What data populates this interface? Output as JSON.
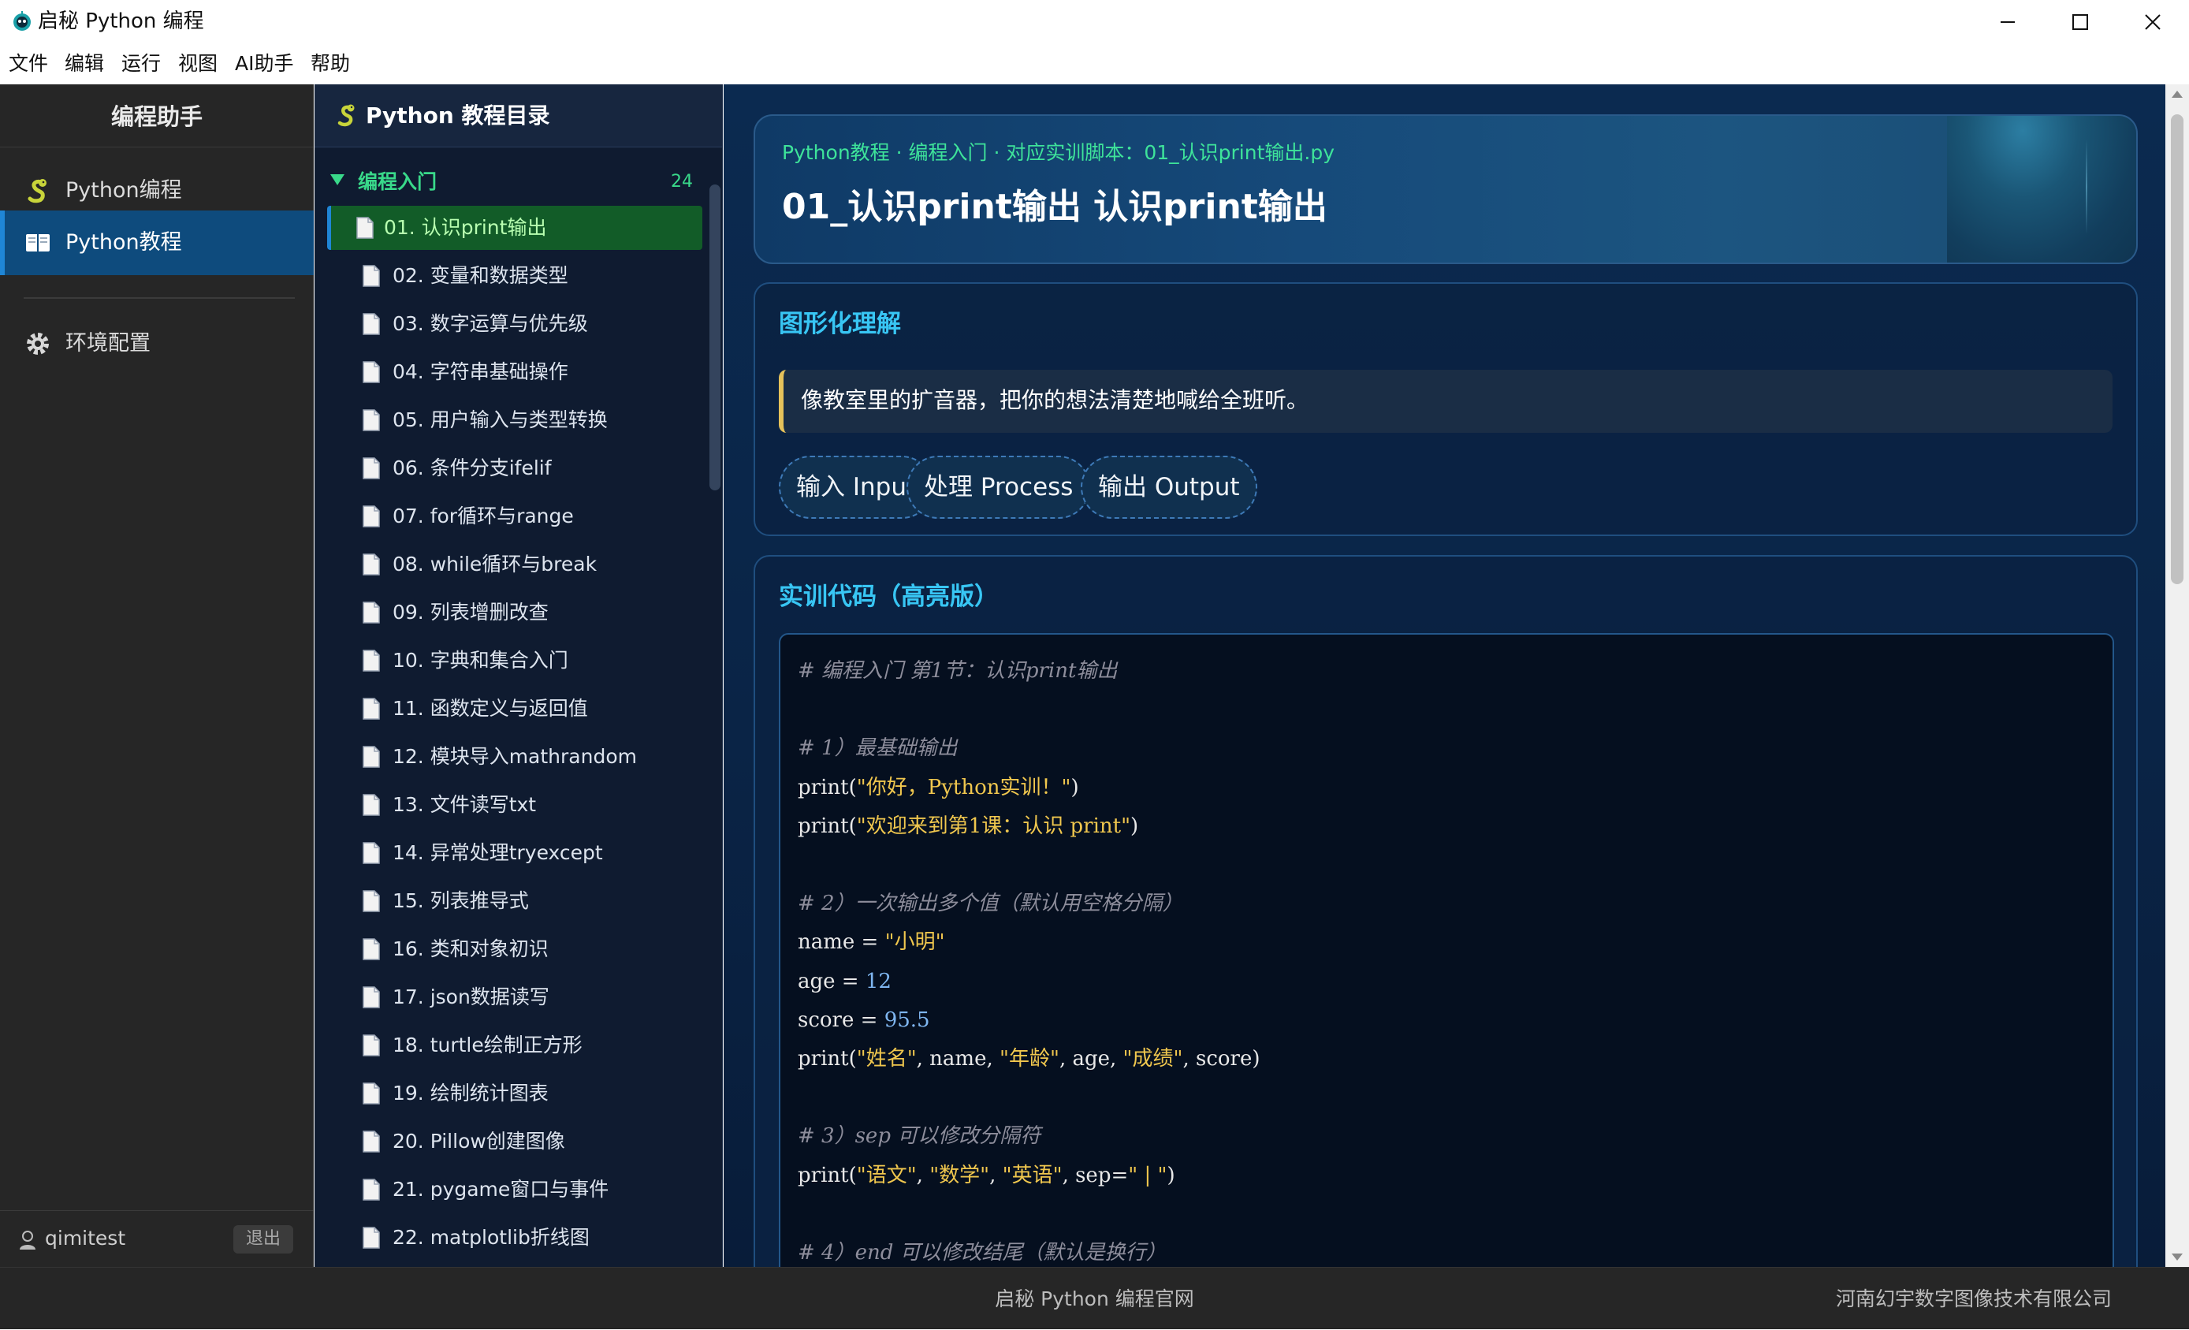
{
  "window": {
    "title": "启秘 Python 编程",
    "icon": "robot-app-icon",
    "controls": [
      "minimize-icon",
      "maximize-icon",
      "close-icon"
    ]
  },
  "menubar": {
    "items": [
      "文件",
      "编辑",
      "运行",
      "视图",
      "AI助手",
      "帮助"
    ]
  },
  "nav": {
    "title": "编程助手",
    "items": [
      {
        "label": "Python编程",
        "icon": "python-snake-icon",
        "active": false
      },
      {
        "label": "Python教程",
        "icon": "book-icon",
        "active": true
      },
      {
        "label": "环境配置",
        "icon": "gear-icon",
        "active": false
      }
    ],
    "user": {
      "name": "qimitest",
      "icon": "user-icon",
      "logout_label": "退出"
    }
  },
  "toc": {
    "title": "Python 教程目录",
    "title_icon": "python-snake-icon",
    "group": {
      "label": "编程入门",
      "count": "24",
      "expanded": true
    },
    "items": [
      "01. 认识print输出",
      "02. 变量和数据类型",
      "03. 数字运算与优先级",
      "04. 字符串基础操作",
      "05. 用户输入与类型转换",
      "06. 条件分支ifelif",
      "07. for循环与range",
      "08. while循环与break",
      "09. 列表增删改查",
      "10. 字典和集合入门",
      "11. 函数定义与返回值",
      "12. 模块导入mathrandom",
      "13. 文件读写txt",
      "14. 异常处理tryexcept",
      "15. 列表推导式",
      "16. 类和对象初识",
      "17. json数据读写",
      "18. turtle绘制正方形",
      "19. 绘制统计图表",
      "20. Pillow创建图像",
      "21. pygame窗口与事件",
      "22. matplotlib折线图"
    ],
    "active_index": 0
  },
  "hero": {
    "breadcrumb": "Python教程 · 编程入门 · 对应实训脚本：01_认识print输出.py",
    "title": "01_认识print输出 认识print输出"
  },
  "concept": {
    "title": "图形化理解",
    "quote": "像教室里的扩音器，把你的想法清楚地喊给全班听。",
    "pills": [
      "输入 Input",
      "处理 Process",
      "输出 Output"
    ]
  },
  "code": {
    "title": "实训代码（高亮版）",
    "lines": [
      [
        {
          "t": "# 编程入门 第1节：认识print输出",
          "k": "c"
        }
      ],
      [],
      [
        {
          "t": "# 1）最基础输出",
          "k": "c"
        }
      ],
      [
        {
          "t": "print(",
          "k": "o"
        },
        {
          "t": "\"你好，Python实训！\"",
          "k": "s"
        },
        {
          "t": ")",
          "k": "o"
        }
      ],
      [
        {
          "t": "print(",
          "k": "o"
        },
        {
          "t": "\"欢迎来到第1课：认识 print\"",
          "k": "s"
        },
        {
          "t": ")",
          "k": "o"
        }
      ],
      [],
      [
        {
          "t": "# 2）一次输出多个值（默认用空格分隔）",
          "k": "c"
        }
      ],
      [
        {
          "t": "name = ",
          "k": "o"
        },
        {
          "t": "\"小明\"",
          "k": "s"
        }
      ],
      [
        {
          "t": "age = ",
          "k": "o"
        },
        {
          "t": "12",
          "k": "n"
        }
      ],
      [
        {
          "t": "score = ",
          "k": "o"
        },
        {
          "t": "95.5",
          "k": "n"
        }
      ],
      [
        {
          "t": "print(",
          "k": "o"
        },
        {
          "t": "\"姓名\"",
          "k": "s"
        },
        {
          "t": ", name, ",
          "k": "o"
        },
        {
          "t": "\"年龄\"",
          "k": "s"
        },
        {
          "t": ", age, ",
          "k": "o"
        },
        {
          "t": "\"成绩\"",
          "k": "s"
        },
        {
          "t": ", score)",
          "k": "o"
        }
      ],
      [],
      [
        {
          "t": "# 3）sep 可以修改分隔符",
          "k": "c"
        }
      ],
      [
        {
          "t": "print(",
          "k": "o"
        },
        {
          "t": "\"语文\"",
          "k": "s"
        },
        {
          "t": ", ",
          "k": "o"
        },
        {
          "t": "\"数学\"",
          "k": "s"
        },
        {
          "t": ", ",
          "k": "o"
        },
        {
          "t": "\"英语\"",
          "k": "s"
        },
        {
          "t": ", sep=",
          "k": "o"
        },
        {
          "t": "\" | \"",
          "k": "s"
        },
        {
          "t": ")",
          "k": "o"
        }
      ],
      [],
      [
        {
          "t": "# 4）end 可以修改结尾（默认是换行）",
          "k": "c"
        }
      ]
    ]
  },
  "footer": {
    "center": "启秘 Python 编程官网",
    "right": "河南幻宇数字图像技术有限公司"
  },
  "colors": {
    "accent_green": "#39d98a",
    "accent_cyan": "#38c6f4",
    "active_nav": "#0e4b7d",
    "active_toc": "#125c28",
    "string_token": "#f0c74e",
    "number_token": "#7fb6f0",
    "comment_token": "#8d8d9b"
  }
}
